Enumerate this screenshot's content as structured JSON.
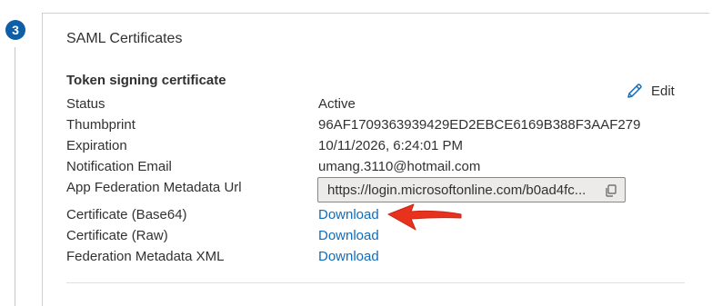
{
  "step": {
    "number": "3"
  },
  "card": {
    "title": "SAML Certificates",
    "section_title": "Token signing certificate",
    "edit_label": "Edit"
  },
  "rows": [
    {
      "label": "Status",
      "value": "Active"
    },
    {
      "label": "Thumbprint",
      "value": "96AF1709363939429ED2EBCE6169B388F3AAF279"
    },
    {
      "label": "Expiration",
      "value": "10/11/2026, 6:24:01 PM"
    },
    {
      "label": "Notification Email",
      "value": "umang.3110@hotmail.com"
    },
    {
      "label": "App Federation Metadata Url",
      "value": "https://login.microsoftonline.com/b0ad4fc..."
    },
    {
      "label": "Certificate (Base64)",
      "value": "Download"
    },
    {
      "label": "Certificate (Raw)",
      "value": "Download"
    },
    {
      "label": "Federation Metadata XML",
      "value": "Download"
    }
  ],
  "colors": {
    "link": "#0f6cbd",
    "badge": "#0f5fa8",
    "annotation_arrow": "#e8321e"
  },
  "icons": {
    "edit": "pencil-icon",
    "copy": "copy-icon",
    "annotation": "red-arrow-annotation"
  }
}
